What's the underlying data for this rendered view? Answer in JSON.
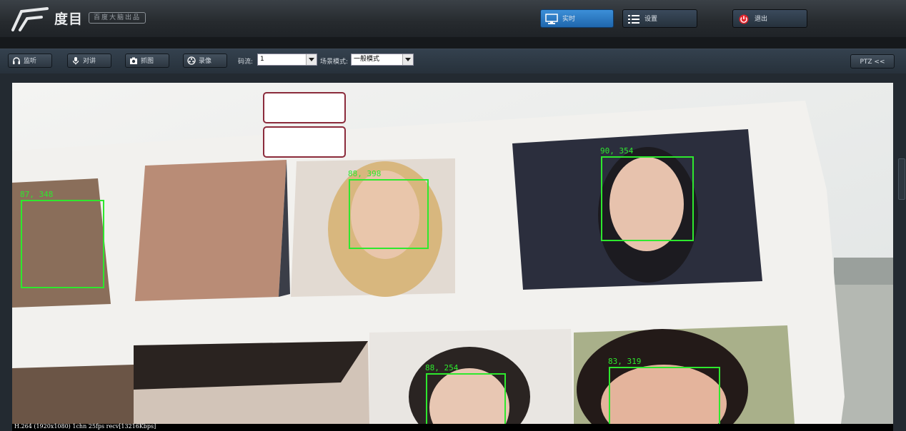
{
  "header": {
    "app_name": "度目",
    "tagline": "百度大脑出品",
    "nav": [
      {
        "label": "实时",
        "icon": "monitor-icon",
        "active": true
      },
      {
        "label": "设置",
        "icon": "list-icon",
        "active": false
      },
      {
        "label": "退出",
        "icon": "power-icon",
        "active": false
      }
    ]
  },
  "toolbar": {
    "buttons": [
      {
        "label": "监听",
        "icon": "headphones-icon"
      },
      {
        "label": "对讲",
        "icon": "microphone-icon"
      },
      {
        "label": "抓图",
        "icon": "camera-icon"
      },
      {
        "label": "录像",
        "icon": "record-icon"
      }
    ],
    "stream_label": "码流:",
    "stream_value": "1",
    "scene_label": "场景模式:",
    "scene_value": "一般模式",
    "ptz_label": "PTZ <<"
  },
  "video": {
    "detections": [
      {
        "label": "87, 348"
      },
      {
        "label": "88, 398"
      },
      {
        "label": "90, 354"
      },
      {
        "label": "88, 254"
      },
      {
        "label": "83, 319"
      }
    ],
    "status_text": "H.264 (1920x1080) 1chn 25fps recv[13216Kbps]"
  },
  "colors": {
    "active_tab": "#2a78c4",
    "detection_box": "#2ee82e",
    "power_icon": "#e0242c"
  }
}
